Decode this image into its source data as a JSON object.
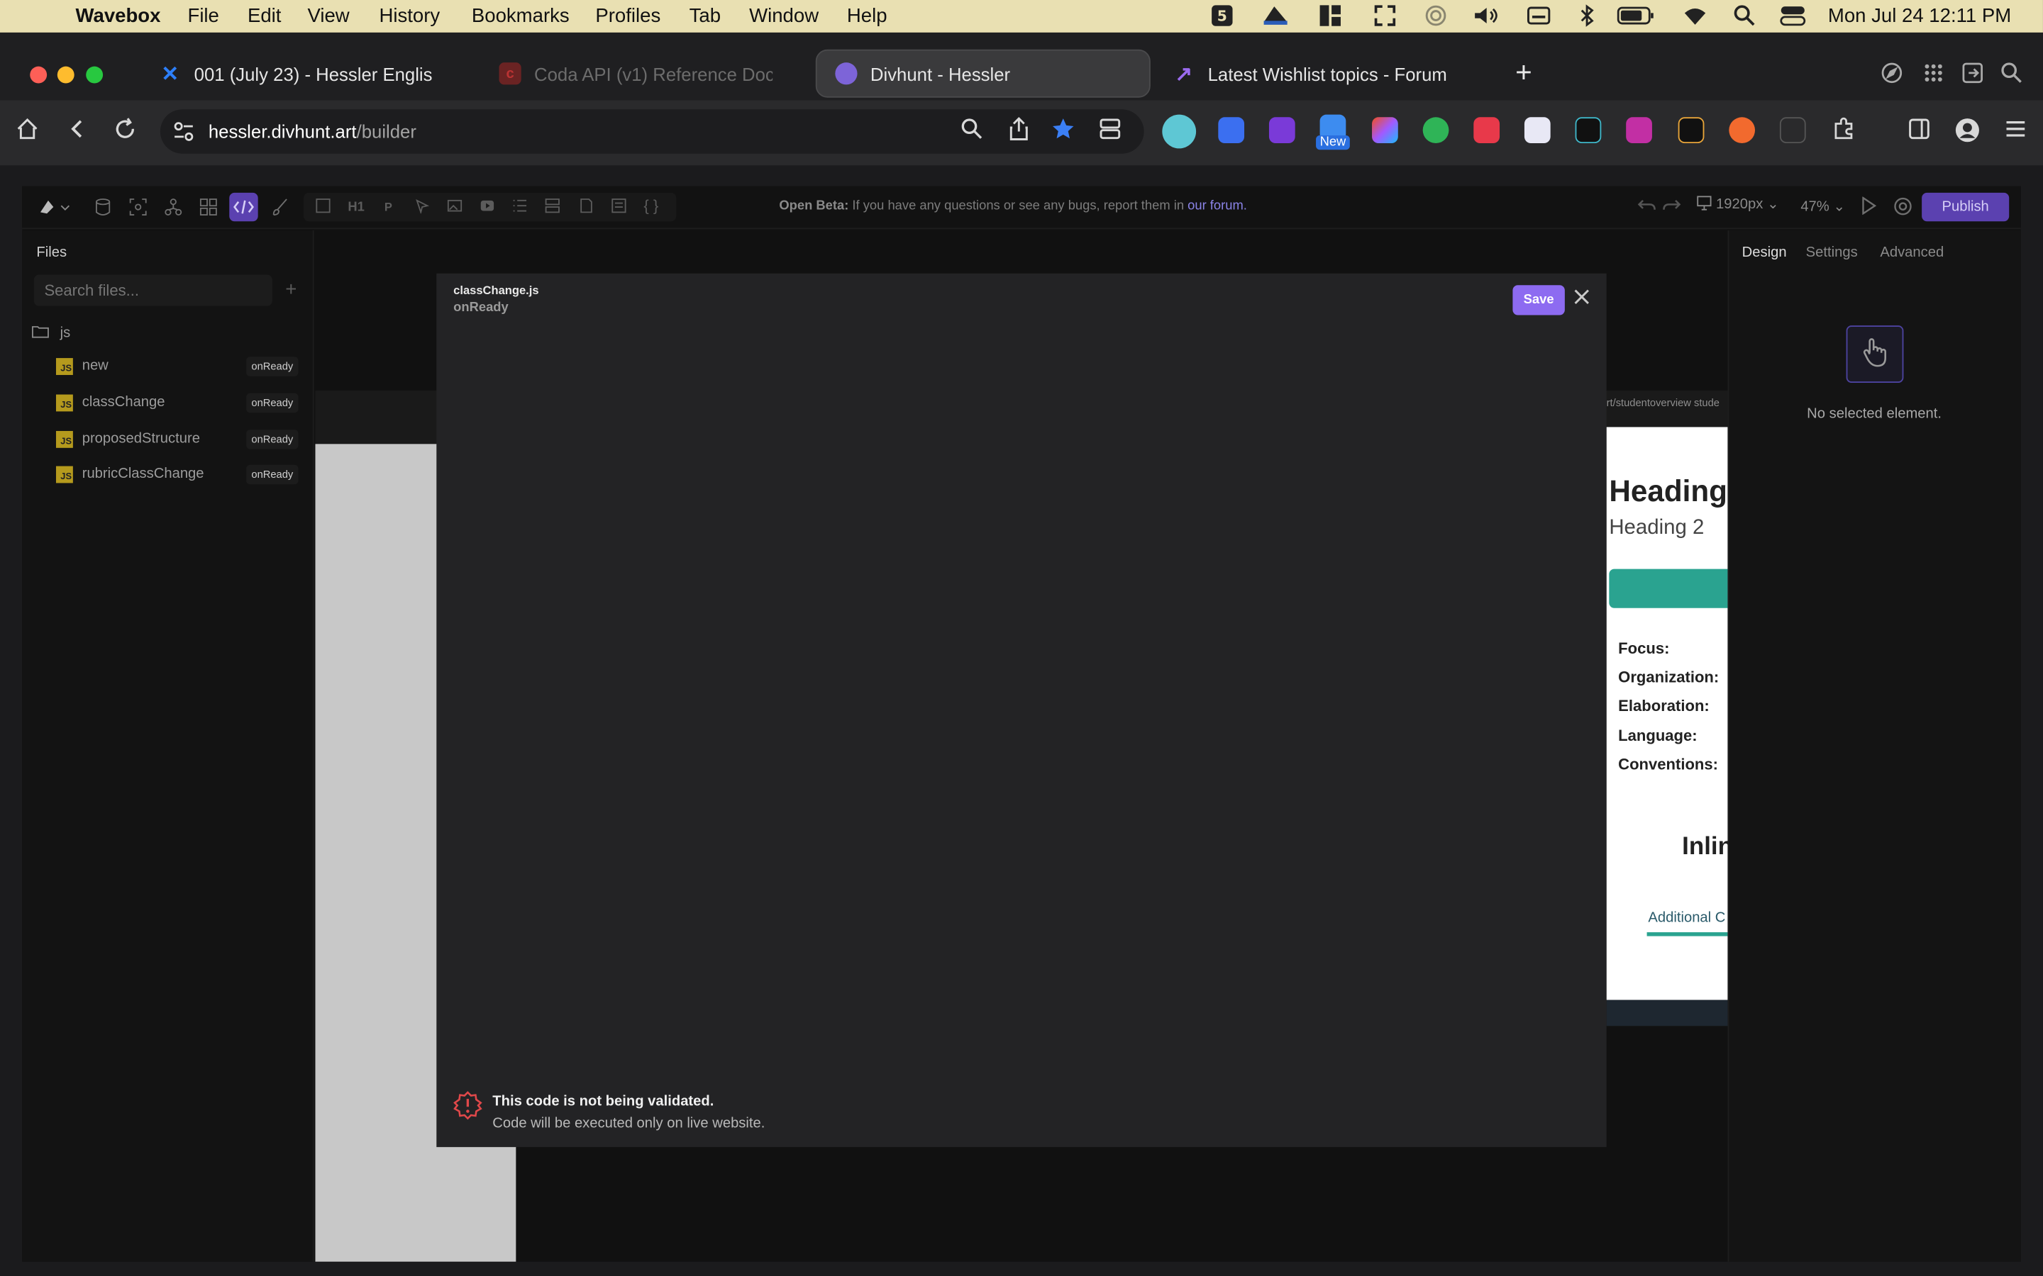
{
  "menubar": {
    "app": "Wavebox",
    "items": [
      "File",
      "Edit",
      "View",
      "History",
      "Bookmarks",
      "Profiles",
      "Tab",
      "Window",
      "Help"
    ],
    "datetime": "Mon Jul 24  12:11 PM"
  },
  "tabs": [
    {
      "label": "001 (July 23) - Hessler Englis",
      "icon": "confluence-icon"
    },
    {
      "label": "Coda API (v1) Reference Doc",
      "icon": "coda-icon"
    },
    {
      "label": "Divhunt - Hessler",
      "icon": "divhunt-icon"
    },
    {
      "label": "Latest Wishlist topics - Forum",
      "icon": "forum-icon"
    }
  ],
  "addressbar": {
    "host": "hessler.divhunt.art",
    "path": "/builder"
  },
  "extension_badge": "New",
  "builder": {
    "beta_notice": {
      "label": "Open Beta:",
      "text": " If you have any questions or see any bugs, report them in ",
      "link": "our forum."
    },
    "viewport": "1920px",
    "zoom": "47%",
    "publish": "Publish",
    "tool_h1": "H1",
    "tool_p": "P"
  },
  "files_panel": {
    "title": "Files",
    "search_placeholder": "Search files...",
    "folder": "js",
    "files": [
      {
        "name": "new",
        "event": "onReady"
      },
      {
        "name": "classChange",
        "event": "onReady"
      },
      {
        "name": "proposedStructure",
        "event": "onReady"
      },
      {
        "name": "rubricClassChange",
        "event": "onReady"
      }
    ]
  },
  "right_panel": {
    "tabs": [
      "Design",
      "Settings",
      "Advanced"
    ],
    "empty_message": "No selected element."
  },
  "preview": {
    "breadcrumb": "rt/studentoverview  stude",
    "heading1": "Heading",
    "heading2": "Heading 2",
    "labels": [
      "Focus:",
      "Organization:",
      "Elaboration:",
      "Language:",
      "Conventions:"
    ],
    "inline_heading": "Inlin",
    "additional_tab": "Additional C"
  },
  "modal": {
    "file_name": "classChange.js",
    "event": "onReady",
    "save_label": "Save",
    "warning_title": "This code is not being validated.",
    "warning_subtitle": "Code will be executed only on live website."
  },
  "colors": {
    "accent": "#8d6bf1",
    "publish": "#5b41b0",
    "teal": "#2aa390",
    "warning": "#e0484a"
  }
}
